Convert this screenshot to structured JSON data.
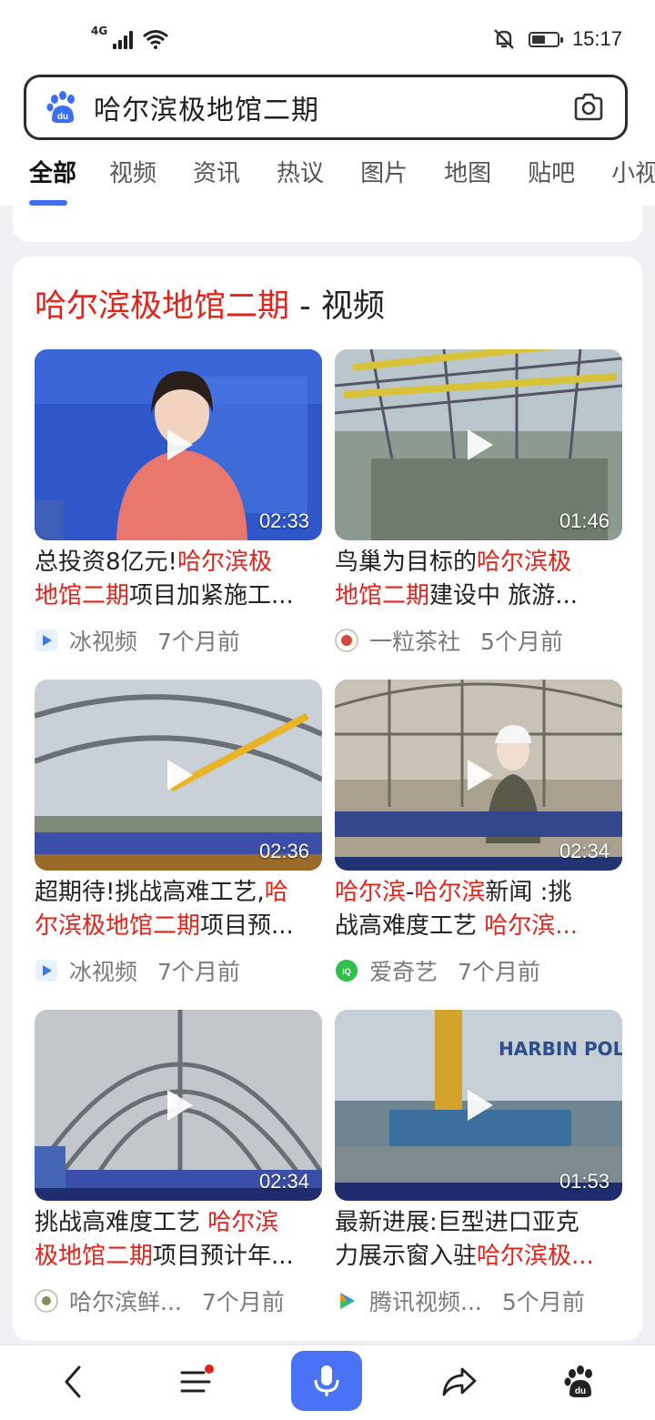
{
  "status_bar": {
    "network": "4G",
    "time": "15:17",
    "battery_level": 0.55
  },
  "search": {
    "query": "哈尔滨极地馆二期"
  },
  "tabs": [
    "全部",
    "视频",
    "资讯",
    "热议",
    "图片",
    "地图",
    "贴吧",
    "小视"
  ],
  "video_section": {
    "title_highlight": "哈尔滨极地馆二期",
    "title_suffix": " - 视频",
    "items": [
      {
        "duration": "02:33",
        "title_parts": [
          [
            "总投资8亿元!",
            "哈尔滨极"
          ],
          [
            "",
            "地馆二期",
            "项目加紧施工..."
          ]
        ],
        "source": "冰视频",
        "age": "7个月前"
      },
      {
        "duration": "01:46",
        "title_parts": [
          [
            "鸟巢为目标的",
            "哈尔滨极"
          ],
          [
            "",
            "地馆二期",
            "建设中 旅游..."
          ]
        ],
        "source": "一粒茶社",
        "age": "5个月前"
      },
      {
        "duration": "02:36",
        "title_parts": [
          [
            "超期待!挑战高难工艺,",
            "哈"
          ],
          [
            "",
            "尔滨极地馆二期",
            "项目预..."
          ]
        ],
        "source": "冰视频",
        "age": "7个月前"
      },
      {
        "duration": "02:34",
        "title_parts": [
          [
            "",
            "哈尔滨",
            "-",
            "哈尔滨",
            "新闻 :挑"
          ],
          [
            "战高难度工艺 ",
            "哈尔滨..."
          ]
        ],
        "source": "爱奇艺",
        "age": "7个月前"
      },
      {
        "duration": "02:34",
        "title_parts": [
          [
            "挑战高难度工艺 ",
            "哈尔滨"
          ],
          [
            "",
            "极地馆二期",
            "项目预计年..."
          ]
        ],
        "source": "哈尔滨鲜...",
        "age": "7个月前"
      },
      {
        "duration": "01:53",
        "title_parts": [
          [
            "最新进展:巨型进口亚克"
          ],
          [
            "力展示窗入驻",
            "哈尔滨极..."
          ]
        ],
        "source": "腾讯视频...",
        "age": "5个月前"
      }
    ]
  },
  "colors": {
    "highlight": "#e2231a",
    "accent": "#4a72f5"
  }
}
